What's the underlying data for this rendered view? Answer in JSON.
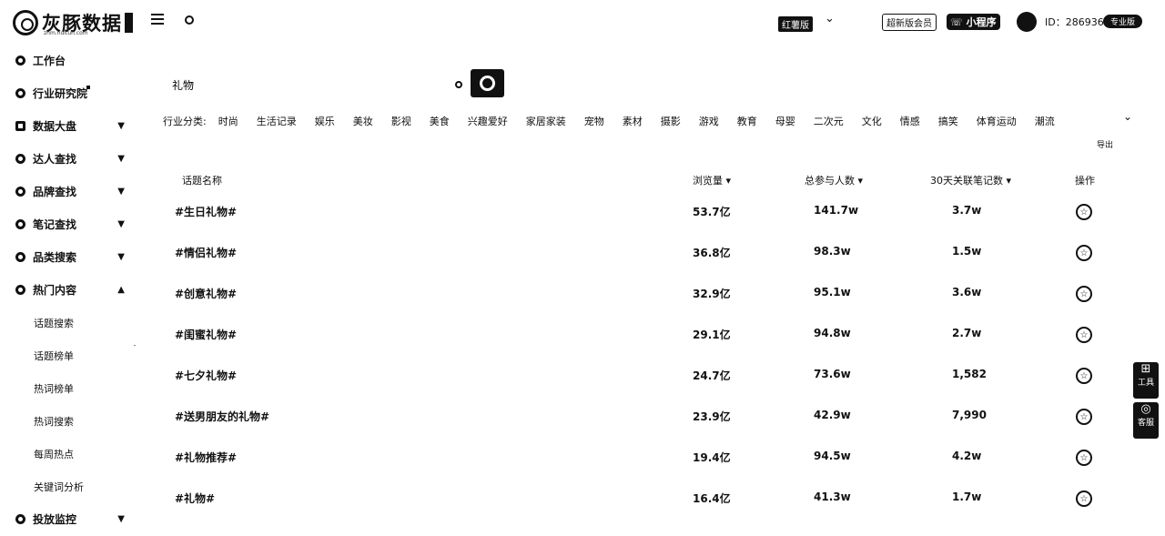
{
  "logo": {
    "text": "灰豚数据",
    "sub": "zhm.huitun.com"
  },
  "nav": {
    "items": [
      {
        "label": "工作台",
        "icon": "home-icon"
      },
      {
        "label": "行业研究院",
        "icon": "research-icon"
      },
      {
        "label": "数据大盘",
        "icon": "chart-icon"
      },
      {
        "label": "达人查找",
        "icon": "user-icon"
      },
      {
        "label": "品牌查找",
        "icon": "brand-icon"
      },
      {
        "label": "笔记查找",
        "icon": "note-icon"
      },
      {
        "label": "品类搜索",
        "icon": "category-icon"
      },
      {
        "label": "热门内容",
        "icon": "hot-icon"
      }
    ],
    "sub_items": [
      "话题搜索",
      "话题榜单",
      "热词榜单",
      "热词搜索",
      "每周热点",
      "关键词分析"
    ],
    "last_item": {
      "label": "投放监控",
      "icon": "monitor-icon"
    }
  },
  "topbar": {
    "version": "红薯版",
    "upgrade": "超新版会员",
    "mini_program": "小程序",
    "user_id": "ID：2869362",
    "badge": "专业版"
  },
  "search": {
    "value": "礼物"
  },
  "categories": {
    "label": "行业分类:",
    "items": [
      "时尚",
      "生活记录",
      "娱乐",
      "美妆",
      "影视",
      "美食",
      "兴趣爱好",
      "家居家装",
      "宠物",
      "素材",
      "摄影",
      "游戏",
      "教育",
      "母婴",
      "二次元",
      "文化",
      "情感",
      "搞笑",
      "体育运动",
      "潮流"
    ]
  },
  "export_label": "导出",
  "table": {
    "headers": [
      "话题名称",
      "浏览量",
      "总参与人数",
      "30天关联笔记数",
      "操作"
    ],
    "rows": [
      {
        "name": "#生日礼物#",
        "views": "53.7亿",
        "participants": "141.7w",
        "notes": "3.7w"
      },
      {
        "name": "#情侣礼物#",
        "views": "36.8亿",
        "participants": "98.3w",
        "notes": "1.5w"
      },
      {
        "name": "#创意礼物#",
        "views": "32.9亿",
        "participants": "95.1w",
        "notes": "3.6w"
      },
      {
        "name": "#闺蜜礼物#",
        "views": "29.1亿",
        "participants": "94.8w",
        "notes": "2.7w"
      },
      {
        "name": "#七夕礼物#",
        "views": "24.7亿",
        "participants": "73.6w",
        "notes": "1,582"
      },
      {
        "name": "#送男朋友的礼物#",
        "views": "23.9亿",
        "participants": "42.9w",
        "notes": "7,990"
      },
      {
        "name": "#礼物推荐#",
        "views": "19.4亿",
        "participants": "94.5w",
        "notes": "4.2w"
      },
      {
        "name": "#礼物#",
        "views": "16.4亿",
        "participants": "41.3w",
        "notes": "1.7w"
      }
    ]
  },
  "float_tabs": [
    "工具",
    "客服"
  ]
}
